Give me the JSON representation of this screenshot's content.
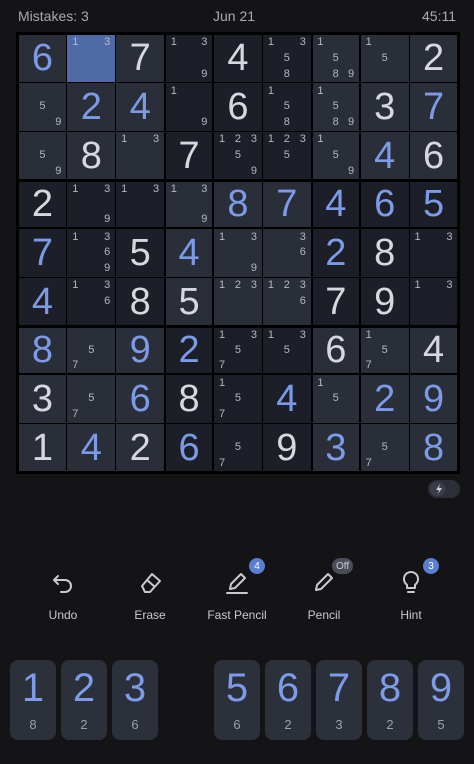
{
  "header": {
    "mistakes": "Mistakes: 3",
    "date": "Jun 21",
    "clock": "45:11"
  },
  "colors": {
    "board_bg": "#1c1f27",
    "box_tint_light": "#2a2e39",
    "selected": "#4f6aa5",
    "given": "#d6d8de",
    "user": "#7c9ae6",
    "accent": "#5a7ed0"
  },
  "selected": [
    0,
    1
  ],
  "grid": [
    [
      {
        "v": "6",
        "k": "user"
      },
      {
        "n": [
          1,
          3
        ]
      },
      {
        "v": "7",
        "k": "given"
      },
      {
        "n": [
          1,
          3,
          9
        ]
      },
      {
        "v": "4",
        "k": "given"
      },
      {
        "n": [
          1,
          3,
          5,
          8
        ]
      },
      {
        "n": [
          1,
          5,
          8,
          9
        ]
      },
      {
        "n": [
          1,
          5
        ]
      },
      {
        "v": "2",
        "k": "given"
      }
    ],
    [
      {
        "n": [
          5,
          9
        ]
      },
      {
        "v": "2",
        "k": "user"
      },
      {
        "v": "4",
        "k": "user"
      },
      {
        "n": [
          1,
          9
        ]
      },
      {
        "v": "6",
        "k": "given"
      },
      {
        "n": [
          1,
          5,
          8
        ]
      },
      {
        "n": [
          1,
          5,
          8,
          9
        ]
      },
      {
        "v": "3",
        "k": "given"
      },
      {
        "v": "7",
        "k": "user"
      }
    ],
    [
      {
        "n": [
          5,
          9
        ]
      },
      {
        "v": "8",
        "k": "given"
      },
      {
        "n": [
          1,
          3
        ]
      },
      {
        "v": "7",
        "k": "given"
      },
      {
        "n": [
          1,
          2,
          3,
          5,
          9
        ]
      },
      {
        "n": [
          1,
          2,
          3,
          5
        ]
      },
      {
        "n": [
          1,
          5,
          9
        ]
      },
      {
        "v": "4",
        "k": "user"
      },
      {
        "v": "6",
        "k": "given"
      }
    ],
    [
      {
        "v": "2",
        "k": "given"
      },
      {
        "n": [
          1,
          3,
          9
        ]
      },
      {
        "n": [
          1,
          3
        ]
      },
      {
        "n": [
          1,
          3,
          9
        ]
      },
      {
        "v": "8",
        "k": "user"
      },
      {
        "v": "7",
        "k": "user"
      },
      {
        "v": "4",
        "k": "user"
      },
      {
        "v": "6",
        "k": "user"
      },
      {
        "v": "5",
        "k": "user"
      }
    ],
    [
      {
        "v": "7",
        "k": "user"
      },
      {
        "n": [
          1,
          3,
          6,
          9
        ]
      },
      {
        "v": "5",
        "k": "given"
      },
      {
        "v": "4",
        "k": "user"
      },
      {
        "n": [
          1,
          3,
          9
        ]
      },
      {
        "n": [
          3,
          6
        ]
      },
      {
        "v": "2",
        "k": "user"
      },
      {
        "v": "8",
        "k": "given"
      },
      {
        "n": [
          1,
          3
        ]
      }
    ],
    [
      {
        "v": "4",
        "k": "user"
      },
      {
        "n": [
          1,
          3,
          6
        ]
      },
      {
        "v": "8",
        "k": "given"
      },
      {
        "v": "5",
        "k": "given"
      },
      {
        "n": [
          1,
          2,
          3
        ]
      },
      {
        "n": [
          1,
          2,
          3,
          6
        ]
      },
      {
        "v": "7",
        "k": "given"
      },
      {
        "v": "9",
        "k": "given"
      },
      {
        "n": [
          1,
          3
        ]
      }
    ],
    [
      {
        "v": "8",
        "k": "user"
      },
      {
        "n": [
          5,
          7
        ]
      },
      {
        "v": "9",
        "k": "user"
      },
      {
        "v": "2",
        "k": "user"
      },
      {
        "n": [
          1,
          3,
          5,
          7
        ]
      },
      {
        "n": [
          1,
          3,
          5
        ]
      },
      {
        "v": "6",
        "k": "given"
      },
      {
        "n": [
          1,
          5,
          7
        ]
      },
      {
        "v": "4",
        "k": "given"
      }
    ],
    [
      {
        "v": "3",
        "k": "given"
      },
      {
        "n": [
          5,
          7
        ]
      },
      {
        "v": "6",
        "k": "user"
      },
      {
        "v": "8",
        "k": "given"
      },
      {
        "n": [
          1,
          5,
          7
        ]
      },
      {
        "v": "4",
        "k": "user"
      },
      {
        "n": [
          1,
          5
        ]
      },
      {
        "v": "2",
        "k": "user"
      },
      {
        "v": "9",
        "k": "user"
      }
    ],
    [
      {
        "v": "1",
        "k": "given"
      },
      {
        "v": "4",
        "k": "user"
      },
      {
        "v": "2",
        "k": "given"
      },
      {
        "v": "6",
        "k": "user"
      },
      {
        "n": [
          5,
          7
        ]
      },
      {
        "v": "9",
        "k": "given"
      },
      {
        "v": "3",
        "k": "user"
      },
      {
        "n": [
          5,
          7
        ]
      },
      {
        "v": "8",
        "k": "user"
      }
    ]
  ],
  "tools": [
    {
      "id": "undo",
      "label": "Undo",
      "icon": "undo-icon",
      "badge": ""
    },
    {
      "id": "erase",
      "label": "Erase",
      "icon": "eraser-icon",
      "badge": ""
    },
    {
      "id": "fast-pencil",
      "label": "Fast Pencil",
      "icon": "fast-pencil-icon",
      "badge": "4"
    },
    {
      "id": "pencil",
      "label": "Pencil",
      "icon": "pencil-icon",
      "badge": "Off"
    },
    {
      "id": "hint",
      "label": "Hint",
      "icon": "lightbulb-icon",
      "badge": "3"
    }
  ],
  "numpad": [
    {
      "digit": "1",
      "count": "8"
    },
    {
      "digit": "2",
      "count": "2"
    },
    {
      "digit": "3",
      "count": "6"
    },
    {
      "digit": "5",
      "count": "6"
    },
    {
      "digit": "6",
      "count": "2"
    },
    {
      "digit": "7",
      "count": "3"
    },
    {
      "digit": "8",
      "count": "2"
    },
    {
      "digit": "9",
      "count": "5"
    }
  ]
}
